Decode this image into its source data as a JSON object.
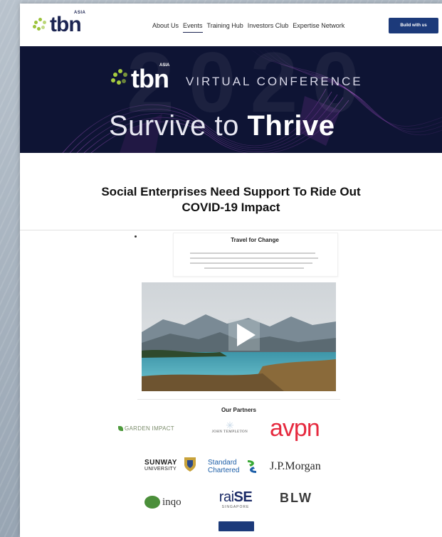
{
  "header": {
    "logo_text": "tbn",
    "logo_superscript": "ASIA",
    "nav": [
      {
        "label": "About Us",
        "active": false
      },
      {
        "label": "Events",
        "active": true
      },
      {
        "label": "Training Hub",
        "active": false
      },
      {
        "label": "Investors Club",
        "active": false
      },
      {
        "label": "Expertise Network",
        "active": false
      }
    ],
    "cta_label": "Build with us"
  },
  "banner": {
    "logo_text": "tbn",
    "logo_superscript": "ASIA",
    "subtitle": "VIRTUAL CONFERENCE",
    "title_light": "Survive to",
    "title_bold": "Thrive",
    "background_year": "2020"
  },
  "article": {
    "headline_line1": "Social Enterprises Need Support To Ride Out",
    "headline_line2": "COVID-19 Impact"
  },
  "embed": {
    "title": "Travel for Change",
    "video_icon": "play-icon",
    "partners_title": "Our Partners",
    "partners": {
      "garden_impact": "GARDEN IMPACT",
      "john_templeton": "JOHN TEMPLETON",
      "avpn": "avpn",
      "sunway_line1": "SUNWAY",
      "sunway_line2": "UNIVERSITY",
      "standard_chartered_line1": "Standard",
      "standard_chartered_line2": "Chartered",
      "jpmorgan": "J.P.Morgan",
      "inqo": "inqo",
      "raise_prefix": "rai",
      "raise_bold": "SE",
      "raise_sub": "SINGAPORE",
      "blw": "BLW"
    }
  },
  "colors": {
    "navy": "#1c2552",
    "brand_green": "#9bc33a",
    "cta_blue": "#1c3a7a",
    "avpn_red": "#e62a3f",
    "banner_bg": "#0e1434"
  }
}
